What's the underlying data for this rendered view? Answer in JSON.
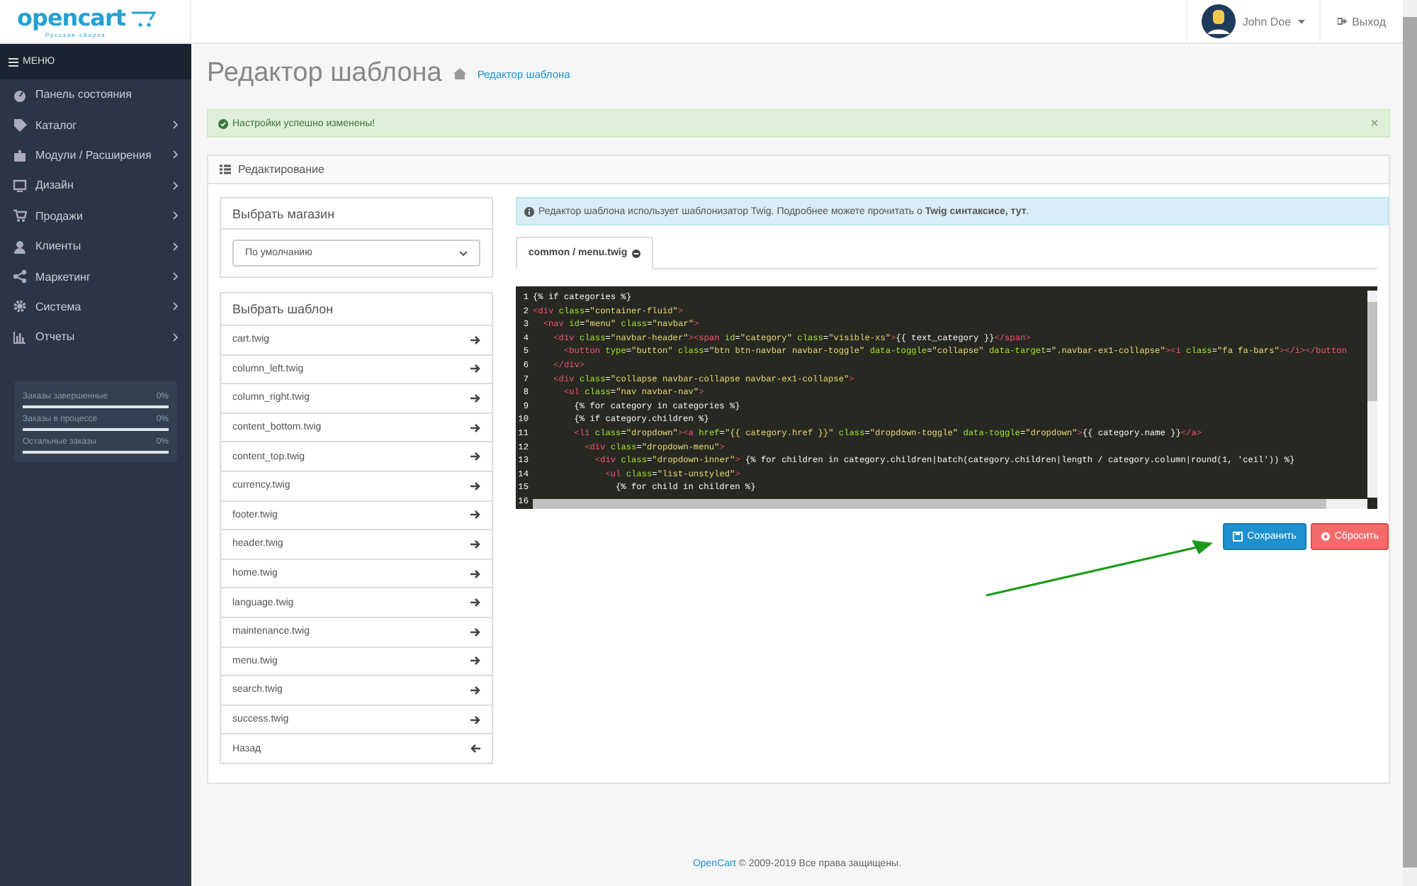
{
  "header": {
    "logo": "opencart",
    "logo_sub": "Русская сборка",
    "user": "John Doe",
    "logout": "Выход"
  },
  "sidebar": {
    "title": "МЕНЮ",
    "items": [
      {
        "label": "Панель состояния",
        "has_children": false
      },
      {
        "label": "Каталог",
        "has_children": true
      },
      {
        "label": "Модули / Расширения",
        "has_children": true
      },
      {
        "label": "Дизайн",
        "has_children": true
      },
      {
        "label": "Продажи",
        "has_children": true
      },
      {
        "label": "Клиенты",
        "has_children": true
      },
      {
        "label": "Маркетинг",
        "has_children": true
      },
      {
        "label": "Система",
        "has_children": true
      },
      {
        "label": "Отчеты",
        "has_children": true
      }
    ],
    "stats": [
      {
        "label": "Заказы завершенные",
        "value": "0%",
        "level": 0
      },
      {
        "label": "Заказы в процессе",
        "value": "0%",
        "level": 0
      },
      {
        "label": "Остальные заказы",
        "value": "0%",
        "level": 0
      }
    ]
  },
  "page": {
    "title": "Редактор шаблона",
    "breadcrumb": "Редактор шаблона"
  },
  "alert": {
    "text": "Настройки успешно изменены!",
    "close": "×"
  },
  "panel": {
    "title": "Редактирование"
  },
  "store": {
    "title": "Выбрать магазин",
    "value": "По умолчанию"
  },
  "templates": {
    "title": "Выбрать шаблон",
    "items": [
      {
        "label": "cart.twig",
        "kind": "file"
      },
      {
        "label": "column_left.twig",
        "kind": "file"
      },
      {
        "label": "column_right.twig",
        "kind": "file"
      },
      {
        "label": "content_bottom.twig",
        "kind": "file"
      },
      {
        "label": "content_top.twig",
        "kind": "file"
      },
      {
        "label": "currency.twig",
        "kind": "file"
      },
      {
        "label": "footer.twig",
        "kind": "file"
      },
      {
        "label": "header.twig",
        "kind": "file"
      },
      {
        "label": "home.twig",
        "kind": "file"
      },
      {
        "label": "language.twig",
        "kind": "file"
      },
      {
        "label": "maintenance.twig",
        "kind": "file"
      },
      {
        "label": "menu.twig",
        "kind": "file"
      },
      {
        "label": "search.twig",
        "kind": "file"
      },
      {
        "label": "success.twig",
        "kind": "file"
      },
      {
        "label": "Назад",
        "kind": "back"
      }
    ]
  },
  "info": "Редактор шаблона использует шаблонизатор Twig. Подробнее можете прочитать о **Twig синтаксисе, тут**.",
  "tabs": [
    {
      "label": "common / menu.twig",
      "selected": true
    }
  ],
  "code_lines": [
    {
      "number": "1",
      "text": "{% if categories %}"
    },
    {
      "number": "2",
      "text": "<div class=\"container-fluid\">"
    },
    {
      "number": "3",
      "text": "  <nav id=\"menu\" class=\"navbar\">"
    },
    {
      "number": "4",
      "text": "    <div class=\"navbar-header\"><span id=\"category\" class=\"visible-xs\">{{ text_category }}</span>"
    },
    {
      "number": "5",
      "text": "      <button type=\"button\" class=\"btn btn-navbar navbar-toggle\" data-toggle=\"collapse\" data-target=\".navbar-ex1-collapse\"><i class=\"fa fa-bars\"></i></button"
    },
    {
      "number": "6",
      "text": "    </div>"
    },
    {
      "number": "7",
      "text": "    <div class=\"collapse navbar-collapse navbar-ex1-collapse\">"
    },
    {
      "number": "8",
      "text": "      <ul class=\"nav navbar-nav\">"
    },
    {
      "number": "9",
      "text": "        {% for category in categories %}"
    },
    {
      "number": "10",
      "text": "        {% if category.children %}"
    },
    {
      "number": "11",
      "text": "        <li class=\"dropdown\"><a href=\"{{ category.href }}\" class=\"dropdown-toggle\" data-toggle=\"dropdown\">{{ category.name }}</a>"
    },
    {
      "number": "12",
      "text": "          <div class=\"dropdown-menu\">"
    },
    {
      "number": "13",
      "text": "            <div class=\"dropdown-inner\"> {% for children in category.children|batch(category.children|length / category.column|round(1, 'ceil')) %}"
    },
    {
      "number": "14",
      "text": "              <ul class=\"list-unstyled\">"
    },
    {
      "number": "15",
      "text": "                {% for child in children %}"
    },
    {
      "number": "16"
    }
  ],
  "buttons": [
    {
      "label": "Сохранить",
      "kind": "save"
    },
    {
      "label": "Сбросить",
      "kind": "reset"
    }
  ],
  "annotation": {
    "kind": "arrow"
  },
  "footer": {
    "link": "OpenCart",
    "text": "© 2009-2019 Все права защищены."
  }
}
